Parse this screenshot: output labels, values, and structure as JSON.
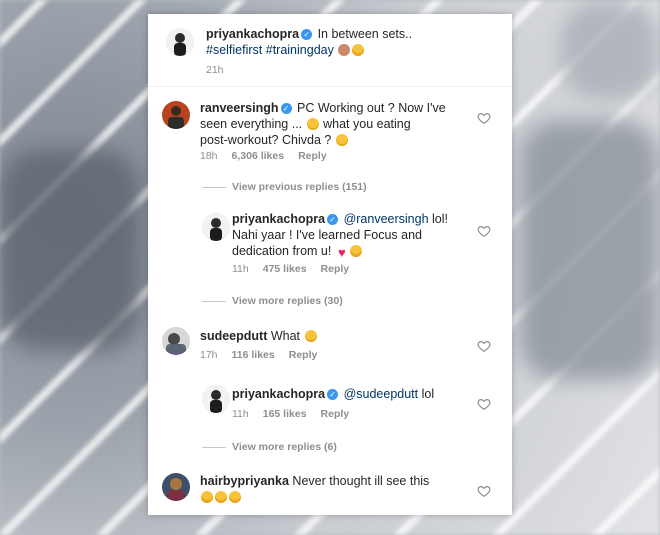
{
  "post": {
    "username": "priyankachopra",
    "caption": "In between sets..",
    "hashtags": "#selfiefirst #trainingday",
    "time": "21h"
  },
  "comments": [
    {
      "username": "ranveersingh",
      "line1": "PC Working out ? Now I've",
      "line2": "seen everything ...",
      "line2b": "what you eating",
      "line3": "post-workout? Chivda ?",
      "time": "18h",
      "likes": "6,306 likes",
      "reply": "Reply"
    },
    {
      "username": "priyankachopra",
      "mention": "@ranveersingh",
      "line1b": "lol!",
      "line2": "Nahi yaar ! I've learned Focus and",
      "line3": "dedication from u!",
      "time": "11h",
      "likes": "475 likes",
      "reply": "Reply"
    },
    {
      "username": "sudeepdutt",
      "text": "What",
      "time": "17h",
      "likes": "116 likes",
      "reply": "Reply"
    },
    {
      "username": "priyankachopra",
      "mention": "@sudeepdutt",
      "text": "lol",
      "time": "11h",
      "likes": "165 likes",
      "reply": "Reply"
    },
    {
      "username": "hairbypriyanka",
      "text": "Never thought ill see this"
    }
  ],
  "view_previous": "View previous replies (151)",
  "view_more_1": "View more replies (30)",
  "view_more_2": "View more replies (6)",
  "colors": {
    "link": "#003569",
    "muted": "#8e8e8e",
    "verified": "#3897f0"
  }
}
